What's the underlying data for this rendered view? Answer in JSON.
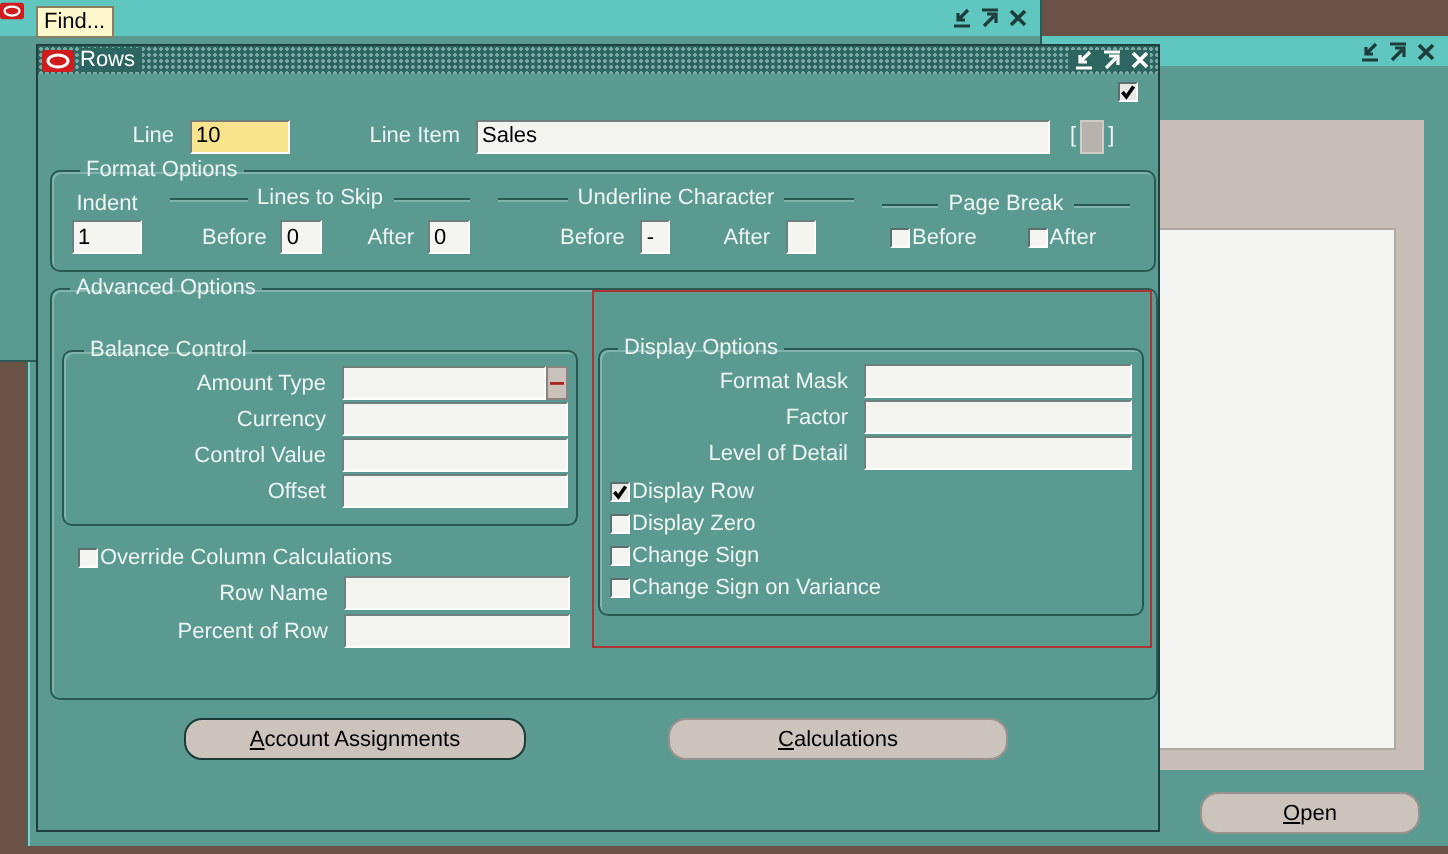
{
  "back_window": {
    "button": {
      "label": "Open",
      "underlined_access_key": true
    }
  },
  "find_window": {
    "title": "Find..."
  },
  "rows_window": {
    "title": "Rows",
    "header_checkbox": {
      "checked": true
    },
    "line": {
      "label": "Line",
      "value": "10",
      "required": true
    },
    "line_item": {
      "label": "Line Item",
      "value": "Sales"
    },
    "line_item_brackets": [
      "[",
      "]"
    ],
    "format_options": {
      "title": "Format Options",
      "indent": {
        "label": "Indent",
        "value": "1"
      },
      "lines_to_skip": {
        "title": "Lines to Skip",
        "fields": [
          {
            "label": "Before",
            "value": "0"
          },
          {
            "label": "After",
            "value": "0"
          }
        ]
      },
      "underline_character": {
        "title": "Underline Character",
        "fields": [
          {
            "label": "Before",
            "value": "-"
          },
          {
            "label": "After"
          }
        ]
      },
      "page_break": {
        "title": "Page Break",
        "options": [
          {
            "label": "Before",
            "checked": false
          },
          {
            "label": "After",
            "checked": false
          }
        ]
      }
    },
    "advanced_options": {
      "title": "Advanced Options",
      "balance_control": {
        "title": "Balance Control",
        "fields": [
          {
            "label": "Amount Type",
            "lov": true
          },
          {
            "label": "Currency"
          },
          {
            "label": "Control Value"
          },
          {
            "label": "Offset"
          }
        ]
      },
      "override_column_calculations": {
        "label": "Override Column Calculations",
        "checked": false
      },
      "override_fields": [
        {
          "label": "Row Name"
        },
        {
          "label": "Percent of Row"
        }
      ],
      "display_options": {
        "title": "Display Options",
        "highlighted": true,
        "fields": [
          {
            "label": "Format Mask"
          },
          {
            "label": "Factor"
          },
          {
            "label": "Level of Detail"
          }
        ],
        "options": [
          {
            "label": "Display Row",
            "checked": true
          },
          {
            "label": "Display Zero",
            "checked": false
          },
          {
            "label": "Change Sign",
            "checked": false
          },
          {
            "label": "Change Sign on Variance",
            "checked": false
          }
        ]
      }
    },
    "buttons": [
      {
        "label": "Account Assignments",
        "underlined_access_key": true,
        "default": true
      },
      {
        "label": "Calculations",
        "underlined_access_key": true,
        "default": false
      }
    ]
  }
}
